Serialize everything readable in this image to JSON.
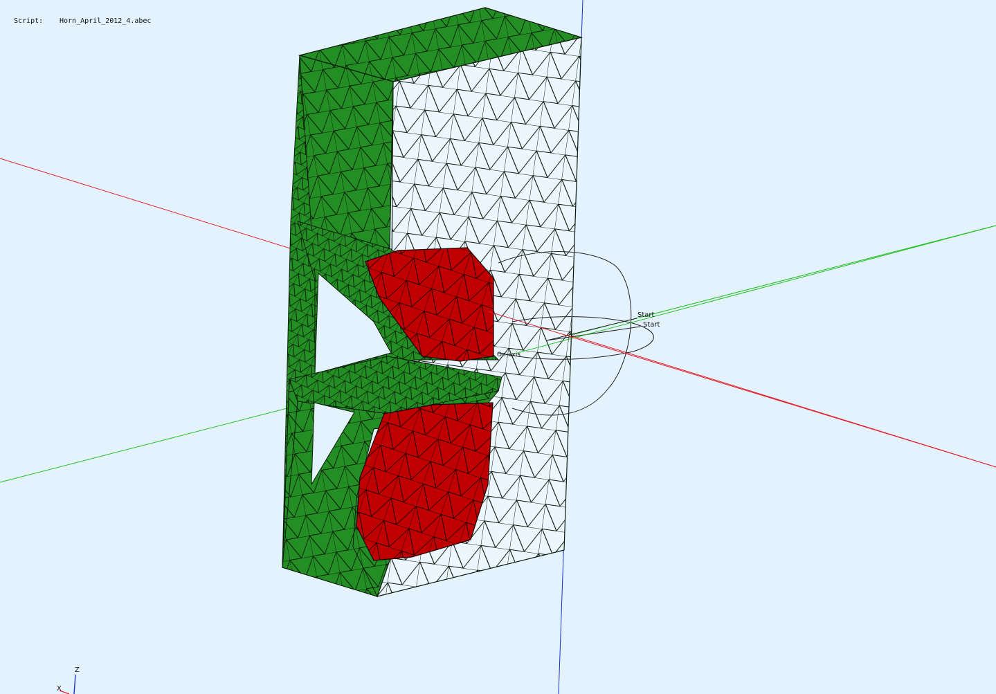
{
  "header": {
    "script_label": "Script:",
    "script_name": "Horn_April_2012_4.abec"
  },
  "overlay_labels": {
    "start_1": "Start",
    "start_2": "Start",
    "on_axis": "On-axis"
  },
  "axis_triad": {
    "z_label": "Z",
    "x_label": "X"
  },
  "colors": {
    "background": "#e3f2fd",
    "enclosure_surface": "#238e23",
    "driver_surface": "#c00000",
    "mesh_lines": "#0a1a0a",
    "axis_x": "#e0202a",
    "axis_y": "#22c022",
    "axis_z": "#1a2fd0",
    "observation_field": "#222222"
  }
}
